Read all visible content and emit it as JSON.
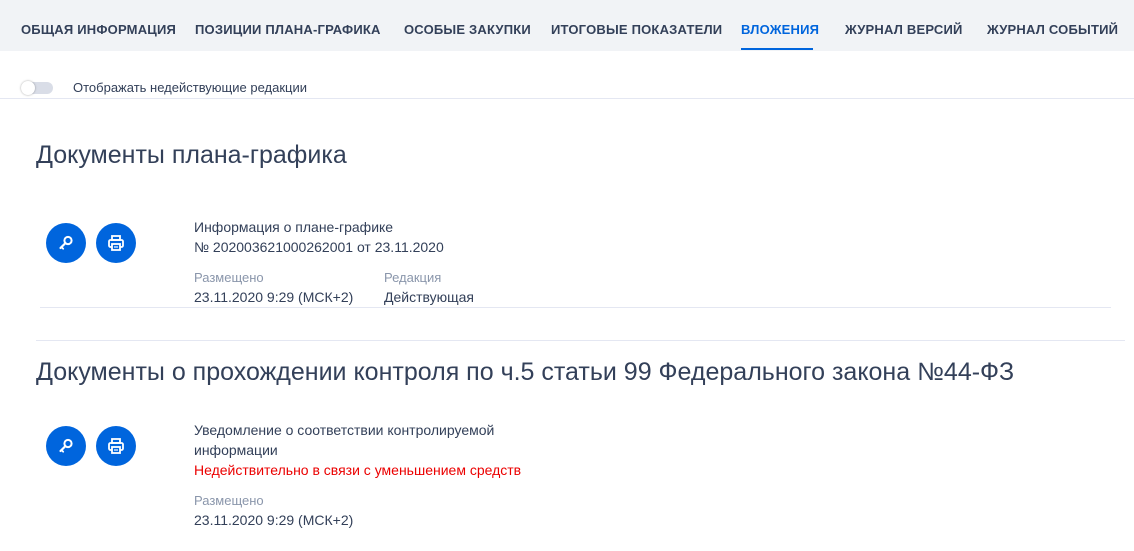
{
  "tabs": [
    {
      "label": "ОБЩАЯ ИНФОРМАЦИЯ"
    },
    {
      "label": "ПОЗИЦИИ ПЛАНА-ГРАФИКА"
    },
    {
      "label": "ОСОБЫЕ ЗАКУПКИ"
    },
    {
      "label": "ИТОГОВЫЕ ПОКАЗАТЕЛИ"
    },
    {
      "label": "ВЛОЖЕНИЯ",
      "active": true
    },
    {
      "label": "ЖУРНАЛ ВЕРСИЙ"
    },
    {
      "label": "ЖУРНАЛ СОБЫТИЙ"
    }
  ],
  "toggle": {
    "label": "Отображать недействующие редакции",
    "on": false
  },
  "sections": [
    {
      "title": "Документы плана-графика",
      "document": {
        "title_line1": "Информация о плане-графике",
        "title_line2": "№ 202003621000262001 от 23.11.2020",
        "posted_label": "Размещено",
        "posted_value": "23.11.2020 9:29 (МСК+2)",
        "edition_label": "Редакция",
        "edition_value": "Действующая",
        "actions": {
          "view_icon": "search-key-icon",
          "print_icon": "printer-icon"
        }
      }
    },
    {
      "title": "Документы о прохождении контроля по ч.5 статьи 99 Федерального закона №44-ФЗ",
      "document": {
        "title_line1": "Уведомление о соответствии контролируемой",
        "title_line2": "информации",
        "status": "Недействительно в связи с уменьшением средств",
        "posted_label": "Размещено",
        "posted_value": "23.11.2020 9:29 (МСК+2)",
        "actions": {
          "view_icon": "search-key-icon",
          "print_icon": "printer-icon"
        }
      }
    }
  ],
  "colors": {
    "accent": "#0065dd",
    "text": "#334059",
    "muted": "#8a96ab",
    "error": "#eb0000",
    "tabs_bg": "#f1f3f6"
  }
}
